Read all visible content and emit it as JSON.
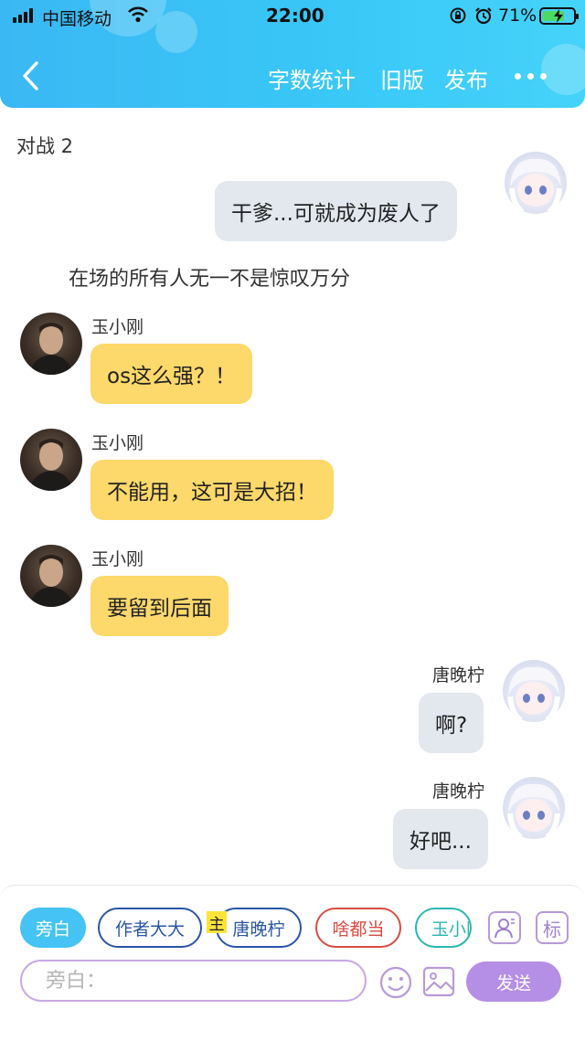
{
  "status_bar": {
    "carrier": "中国移动",
    "time": "22:00",
    "battery_percent": "71%",
    "battery_level": 0.71
  },
  "header": {
    "back_icon": "chevron-left-icon",
    "word_count": "字数统计",
    "old_version": "旧版",
    "publish": "发布",
    "more_icon": "more-dots-icon"
  },
  "chat": {
    "title": "对战 2",
    "narration": "在场的所有人无一不是惊叹万分",
    "messages": [
      {
        "side": "right",
        "sender": "",
        "text": "干爹...可就成为废人了"
      },
      {
        "side": "left",
        "sender": "玉小刚",
        "text": "os这么强？！"
      },
      {
        "side": "left",
        "sender": "玉小刚",
        "text": "不能用，这可是大招！"
      },
      {
        "side": "left",
        "sender": "玉小刚",
        "text": "要留到后面"
      },
      {
        "side": "right",
        "sender": "唐晚柠",
        "text": "啊?"
      },
      {
        "side": "right",
        "sender": "唐晚柠",
        "text": "好吧..."
      }
    ]
  },
  "composer": {
    "roles": [
      {
        "label": "旁白",
        "color": "#45c3f4"
      },
      {
        "label": "作者大大",
        "color": "#2a55a8"
      },
      {
        "label": "唐晚柠",
        "color": "#2a55a8"
      },
      {
        "label": "啥都当",
        "color": "#d74c43"
      },
      {
        "label": "玉小刚",
        "color": "#2bb6b0"
      }
    ],
    "main_badge": "主",
    "role_settings_icon": "person-card-icon",
    "tag_button": "标",
    "input_placeholder": "旁白：",
    "emoji_icon": "emoji-icon",
    "image_icon": "image-icon",
    "send": "发送"
  }
}
